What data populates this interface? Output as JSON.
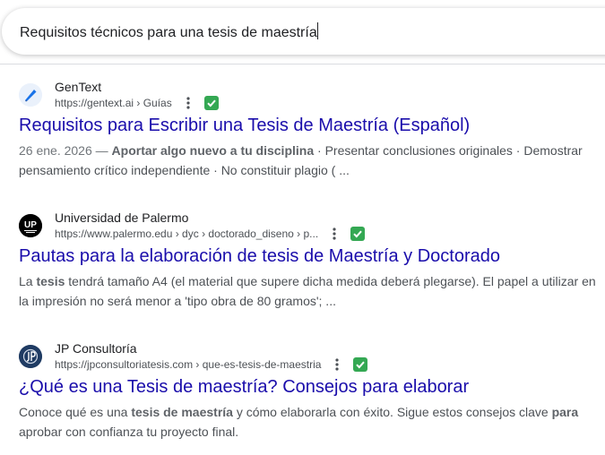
{
  "search": {
    "query": "Requisitos técnicos para una tesis de maestría"
  },
  "results": [
    {
      "site_name": "GenText",
      "url": "https://gentext.ai › Guías",
      "title": "Requisitos para Escribir una Tesis de Maestría (Español)",
      "date": "26 ene. 2026 — ",
      "snippet": [
        {
          "t": "Aportar algo nuevo a tu disciplina",
          "b": true
        },
        {
          "t": " · Presentar conclusiones originales · Demostrar pensamiento crítico independiente · No constituir plagio ( ...",
          "b": false
        }
      ],
      "favicon_icon": "feather-pen-icon",
      "favicon_color": "#1a73e8"
    },
    {
      "site_name": "Universidad de Palermo",
      "url": "https://www.palermo.edu › dyc › doctorado_diseno › p...",
      "title": "Pautas para la elaboración de tesis de Maestría y Doctorado",
      "date": "",
      "snippet": [
        {
          "t": "La ",
          "b": false
        },
        {
          "t": "tesis",
          "b": true
        },
        {
          "t": " tendrá tamaño A4 (el material que supere dicha medida deberá plegarse). El papel a utilizar en la impresión no será menor a 'tipo obra de 80 gramos'; ...",
          "b": false
        }
      ],
      "favicon_icon": "up-logo-icon",
      "favicon_text": "UP",
      "favicon_color": "#000000"
    },
    {
      "site_name": "JP Consultoría",
      "url": "https://jpconsultoriatesis.com › que-es-tesis-de-maestria",
      "title": "¿Qué es una Tesis de maestría? Consejos para elaborar",
      "date": "",
      "snippet": [
        {
          "t": "Conoce qué es una ",
          "b": false
        },
        {
          "t": "tesis de maestría",
          "b": true
        },
        {
          "t": " y cómo elaborarla con éxito. Sigue estos consejos clave ",
          "b": false
        },
        {
          "t": "para",
          "b": true
        },
        {
          "t": " aprobar con confianza tu proyecto final.",
          "b": false
        }
      ],
      "favicon_icon": "jp-logo-icon",
      "favicon_color": "#1f3b63"
    }
  ],
  "colors": {
    "title_link": "#1a0dab",
    "verified_badge": "#34a853"
  }
}
